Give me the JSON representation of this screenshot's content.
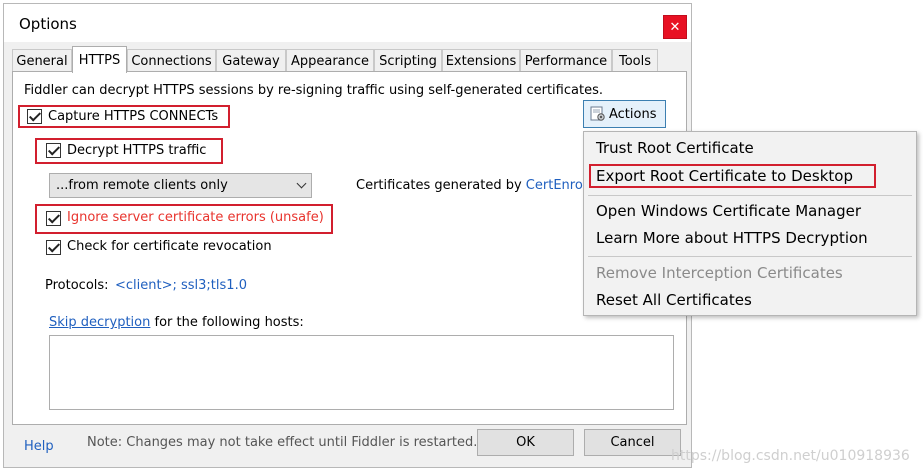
{
  "window": {
    "title": "Options",
    "close_label": "✕"
  },
  "tabs": [
    {
      "label": "General"
    },
    {
      "label": "HTTPS"
    },
    {
      "label": "Connections"
    },
    {
      "label": "Gateway"
    },
    {
      "label": "Appearance"
    },
    {
      "label": "Scripting"
    },
    {
      "label": "Extensions"
    },
    {
      "label": "Performance"
    },
    {
      "label": "Tools"
    }
  ],
  "https": {
    "description": "Fiddler can decrypt HTTPS sessions by re-signing traffic using self-generated certificates.",
    "capture_connects": {
      "label": "Capture HTTPS CONNECTs",
      "checked": true
    },
    "decrypt_traffic": {
      "label": "Decrypt HTTPS traffic",
      "checked": true
    },
    "from_select": {
      "value": "...from remote clients only"
    },
    "certs_generated_label": "Certificates generated by",
    "certs_generator_link": "CertEnroll",
    "ignore_errors": {
      "label": "Ignore server certificate errors (unsafe)",
      "checked": true,
      "color": "#e8332d"
    },
    "check_revocation": {
      "label": "Check for certificate revocation",
      "checked": true
    },
    "protocols_label": "Protocols:",
    "protocols_value": "<client>; ssl3;tls1.0",
    "skip_decryption_link": "Skip decryption",
    "skip_decryption_rest": "for the following hosts:",
    "hosts_value": ""
  },
  "actions_button": {
    "label": "Actions",
    "icon": "gear-certificate-icon"
  },
  "actions_menu": {
    "items": [
      {
        "label": "Trust Root Certificate",
        "enabled": true
      },
      {
        "label": "Export Root Certificate to Desktop",
        "enabled": true
      },
      {
        "label": "Open Windows Certificate Manager",
        "enabled": true
      },
      {
        "label": "Learn More about HTTPS Decryption",
        "enabled": true
      },
      {
        "label": "Remove Interception Certificates",
        "enabled": false
      },
      {
        "label": "Reset All Certificates",
        "enabled": true
      }
    ]
  },
  "footer": {
    "help_label": "Help",
    "note": "Note: Changes may not take effect until Fiddler is restarted.",
    "ok_label": "OK",
    "cancel_label": "Cancel"
  },
  "watermark": "https://blog.csdn.net/u010918936",
  "colors": {
    "highlight_red": "#d21f2e",
    "link_blue": "#1f5fbf",
    "close_red": "#e81123"
  }
}
